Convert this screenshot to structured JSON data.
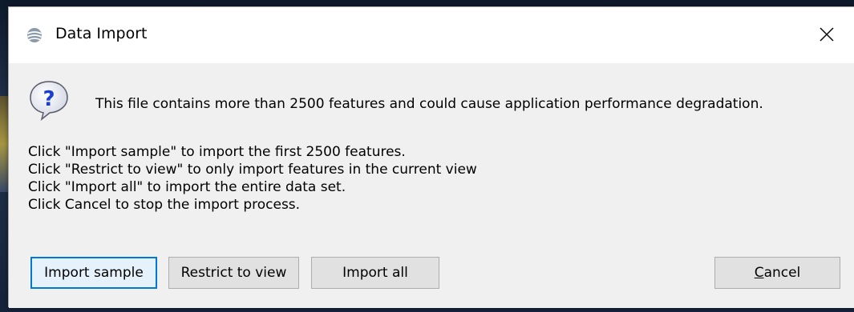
{
  "window": {
    "title": "Data Import",
    "close_glyph": "✕"
  },
  "message": {
    "main": "This file contains more than 2500 features and could cause application performance degradation.",
    "lines": [
      "Click \"Import sample\" to import the first 2500 features.",
      "Click \"Restrict to view\" to only import features in the current view",
      "Click \"Import all\" to import the entire data set.",
      "Click Cancel to stop the import process."
    ]
  },
  "buttons": {
    "import_sample": "Import sample",
    "restrict_to_view": "Restrict to view",
    "import_all": "Import all",
    "cancel_first_letter": "C",
    "cancel_rest": "ancel"
  },
  "icons": {
    "app": "google-earth-globe-icon",
    "question": "question-icon",
    "close": "close-icon"
  },
  "colors": {
    "question_blue": "#1a3fd0",
    "default_button_border": "#0078d7"
  }
}
